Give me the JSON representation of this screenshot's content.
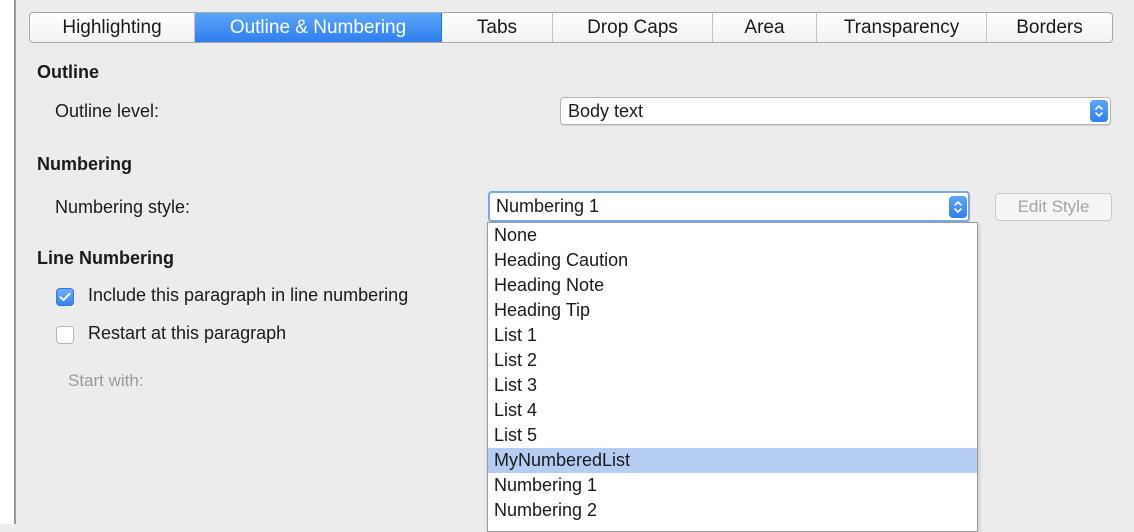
{
  "tabs": [
    {
      "label": "Highlighting",
      "active": false
    },
    {
      "label": "Outline & Numbering",
      "active": true
    },
    {
      "label": "Tabs",
      "active": false
    },
    {
      "label": "Drop Caps",
      "active": false
    },
    {
      "label": "Area",
      "active": false
    },
    {
      "label": "Transparency",
      "active": false
    },
    {
      "label": "Borders",
      "active": false
    }
  ],
  "outline": {
    "title": "Outline",
    "level_label": "Outline level:",
    "level_value": "Body text"
  },
  "numbering": {
    "title": "Numbering",
    "style_label": "Numbering style:",
    "style_value": "Numbering 1",
    "edit_style_label": "Edit Style",
    "options": [
      "None",
      "Heading Caution",
      "Heading Note",
      "Heading Tip",
      "List 1",
      "List 2",
      "List 3",
      "List 4",
      "List 5",
      "MyNumberedList",
      "Numbering 1",
      "Numbering 2"
    ],
    "highlighted_option": "MyNumberedList"
  },
  "line_numbering": {
    "title": "Line Numbering",
    "include_label": "Include this paragraph in line numbering",
    "include_checked": true,
    "restart_label": "Restart at this paragraph",
    "restart_checked": false,
    "start_with_label": "Start with:"
  },
  "colors": {
    "accent": "#2f7ef0",
    "highlight": "#b5cdf2",
    "background": "#ececec"
  }
}
